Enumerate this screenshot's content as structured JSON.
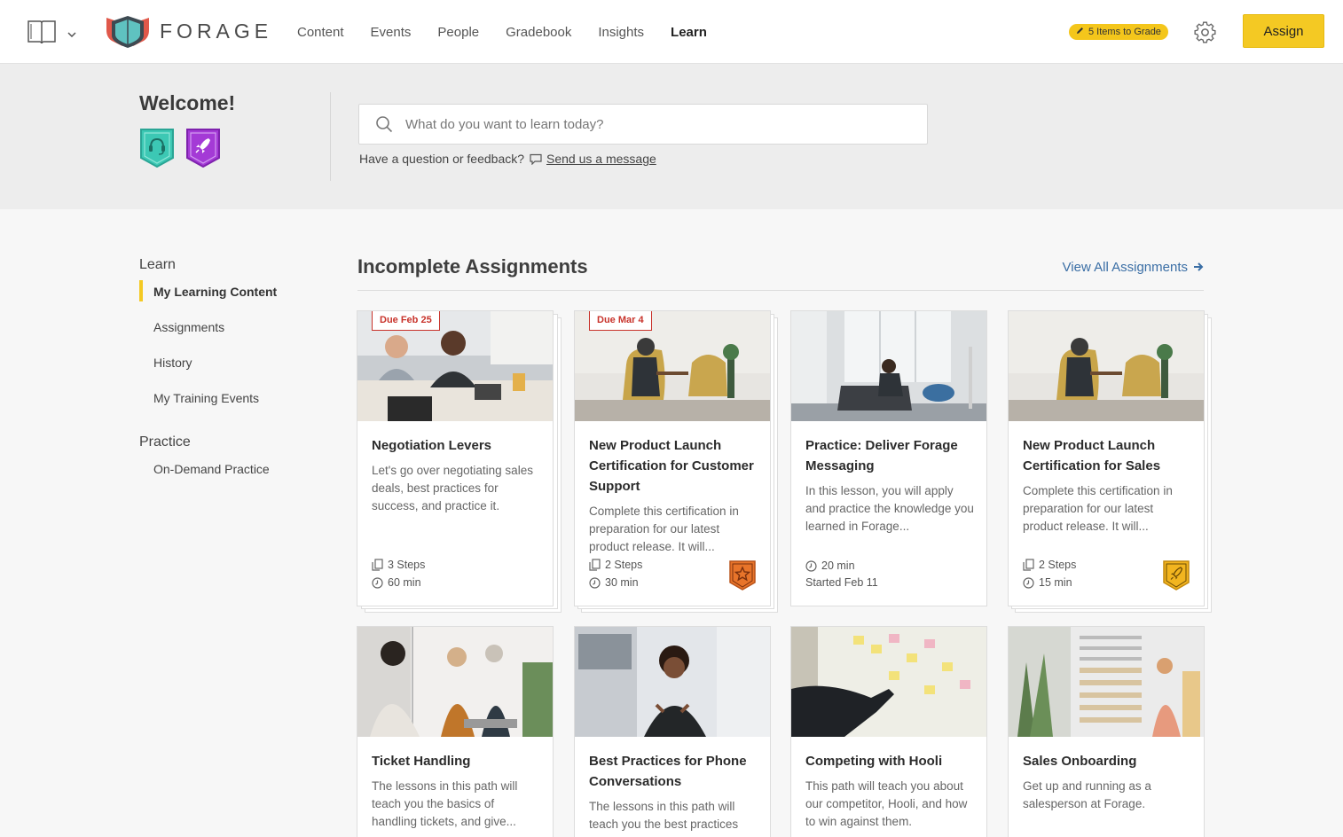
{
  "header": {
    "logo_text": "FORAGE",
    "nav": [
      {
        "label": "Content",
        "active": false
      },
      {
        "label": "Events",
        "active": false
      },
      {
        "label": "People",
        "active": false
      },
      {
        "label": "Gradebook",
        "active": false
      },
      {
        "label": "Insights",
        "active": false
      },
      {
        "label": "Learn",
        "active": true
      }
    ],
    "grade_badge": "5 Items to Grade",
    "assign_label": "Assign"
  },
  "welcome": {
    "title": "Welcome!",
    "search_placeholder": "What do you want to learn today?",
    "feedback_text": "Have a question or feedback?",
    "feedback_link": "Send us a message"
  },
  "sidebar": {
    "learn_heading": "Learn",
    "learn_items": [
      "My Learning Content",
      "Assignments",
      "History",
      "My Training Events"
    ],
    "practice_heading": "Practice",
    "practice_items": [
      "On-Demand Practice"
    ]
  },
  "main": {
    "title": "Incomplete Assignments",
    "view_all": "View All Assignments",
    "cards": [
      {
        "title": "Negotiation Levers",
        "due": "Due Feb 25",
        "desc": "Let's go over negotiating sales deals, best practices for success, and practice it.",
        "steps": "3 Steps",
        "time": "60 min",
        "badge": ""
      },
      {
        "title": "New Product Launch Certification for Customer Support",
        "due": "Due Mar 4",
        "desc": "Complete this certification in preparation for our latest product release. It will...",
        "steps": "2 Steps",
        "time": "30 min",
        "badge": "star"
      },
      {
        "title": "Practice: Deliver Forage Messaging",
        "due": "",
        "desc": "In this lesson, you will apply and practice the knowledge you learned in Forage...",
        "steps": "",
        "time": "20 min",
        "started": "Started Feb 11",
        "badge": ""
      },
      {
        "title": "New Product Launch Certification for Sales",
        "due": "",
        "desc": "Complete this certification in preparation for our latest product release. It will...",
        "steps": "2 Steps",
        "time": "15 min",
        "badge": "rocket"
      },
      {
        "title": "Ticket Handling",
        "desc": "The lessons in this path will teach you the basics of handling tickets, and give..."
      },
      {
        "title": "Best Practices for Phone Conversations",
        "desc": "The lessons in this path will teach you the best practices"
      },
      {
        "title": "Competing with Hooli",
        "desc": "This path will teach you about our competitor, Hooli, and how to win against them."
      },
      {
        "title": "Sales Onboarding",
        "desc": "Get up and running as a salesperson at Forage."
      }
    ]
  },
  "colors": {
    "accent_yellow": "#f4c923",
    "due_red": "#c8332b",
    "link_blue": "#3a6ea5",
    "badge_teal": "#3cc8b4",
    "badge_purple": "#a43ad6",
    "badge_orange": "#e8742a"
  },
  "icons": [
    "book-icon",
    "chevron-down-icon",
    "pencil-icon",
    "gear-icon",
    "search-icon",
    "chat-icon",
    "arrow-right-icon",
    "steps-icon",
    "clock-icon",
    "headset-badge-icon",
    "rocket-badge-icon",
    "star-badge-icon"
  ]
}
